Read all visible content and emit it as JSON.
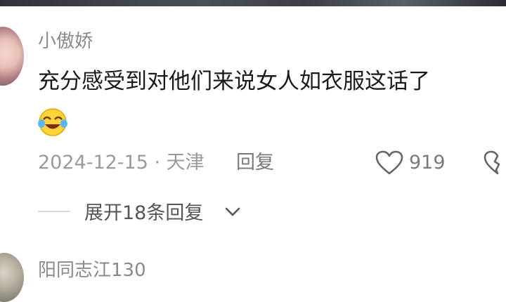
{
  "comment": {
    "username": "小傲娇",
    "text": "充分感受到对他们来说女人如衣服这话了",
    "emoji": "crying-laughing-emoji",
    "meta": "2024-12-15 · 天津",
    "reply_label": "回复",
    "like_count": "919",
    "expand_label": "展开18条回复"
  },
  "next_comment": {
    "username": "阳同志江130"
  }
}
